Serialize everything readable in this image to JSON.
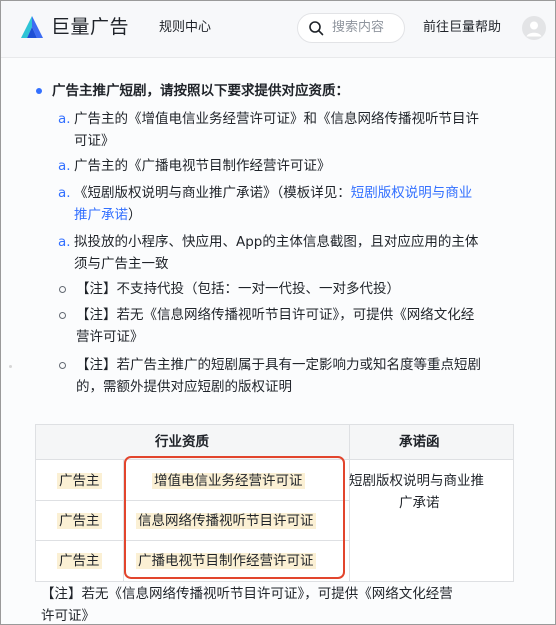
{
  "header": {
    "brand": "巨量广告",
    "rules_center": "规则中心",
    "search_placeholder": "搜索内容",
    "help": "前往巨量帮助"
  },
  "main": {
    "heading": "广告主推广短剧，请按照以下要求提供对应资质：",
    "items": [
      {
        "marker": "a.",
        "line1": "广告主的《增值电信业务经营许可证》和《信息网络传播视听节目许",
        "line2": "可证》"
      },
      {
        "marker": "a.",
        "line1": "广告主的《广播电视节目制作经营许可证》"
      },
      {
        "marker": "a.",
        "line1_prefix": "《短剧版权说明与商业推广承诺》（模板详见：",
        "link1": "短剧版权说明与商业",
        "link2": "推广承诺",
        "line2_suffix": "）"
      },
      {
        "marker": "a.",
        "line1": "拟投放的小程序、快应用、App的主体信息截图，且对应应用的主体",
        "line2": "须与广告主一致"
      }
    ],
    "notes": [
      {
        "line1": "【注】不支持代投（包括：一对一代投、一对多代投）"
      },
      {
        "line1": "【注】若无《信息网络传播视听节目许可证》，可提供《网络文化经",
        "line2": "营许可证》"
      },
      {
        "line1": "【注】若广告主推广的短剧属于具有一定影响力或知名度等重点短剧",
        "line2": "的，需额外提供对应短剧的版权证明"
      }
    ]
  },
  "table": {
    "headers": [
      "行业资质",
      "承诺函"
    ],
    "rows": [
      {
        "role": "广告主",
        "license": "增值电信业务经营许可证"
      },
      {
        "role": "广告主",
        "license": "信息网络传播视听节目许可证"
      },
      {
        "role": "广告主",
        "license": "广播电视节目制作经营许可证"
      }
    ],
    "commitment_line1": "短剧版权说明与商业推",
    "commitment_line2": "广承诺"
  },
  "footer_note": {
    "line1": "【注】若无《信息网络传播视听节目许可证》，可提供《网络文化经营",
    "line2": "许可证》"
  },
  "colors": {
    "accent_blue": "#3370ff",
    "highlight": "#fbf0d4",
    "annotation_red": "#e2452d"
  },
  "icons": [
    "juliang-logo-icon",
    "search-icon",
    "user-avatar-icon"
  ]
}
